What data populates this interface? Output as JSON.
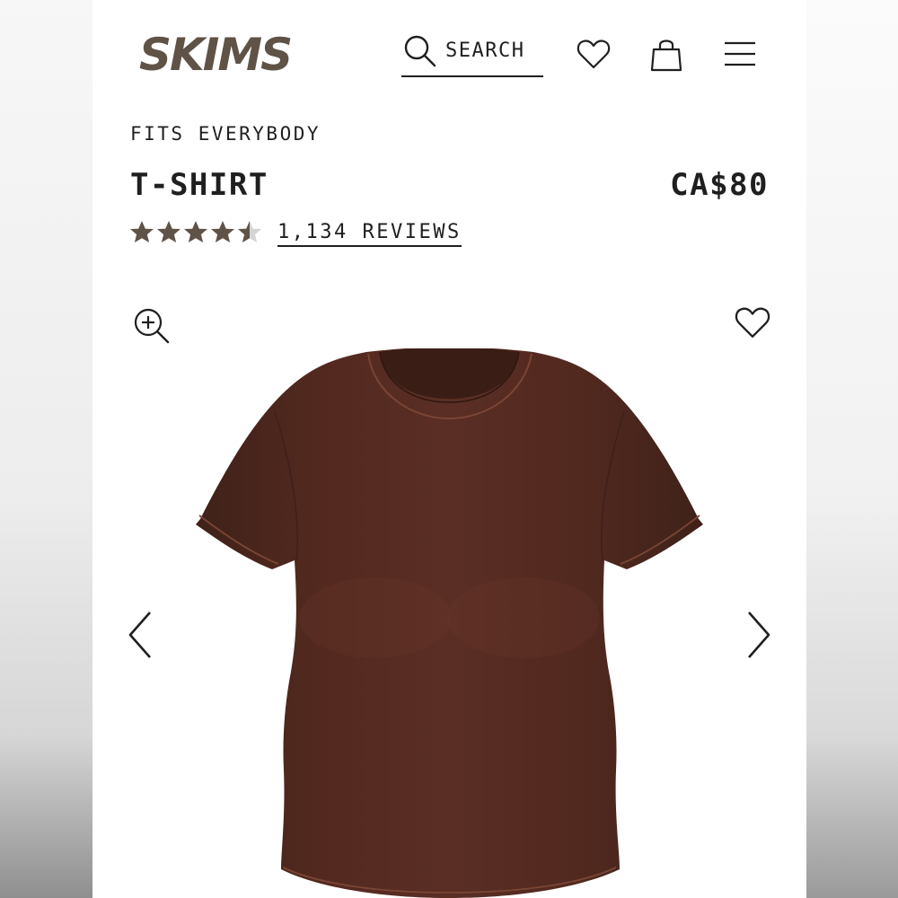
{
  "brand": {
    "name": "SKIMS",
    "color": "#5f5246"
  },
  "header": {
    "search_label": "SEARCH",
    "icons": [
      "search-icon",
      "heart-icon",
      "shopping-bag-icon",
      "menu-icon"
    ]
  },
  "product": {
    "eyebrow": "FITS EVERYBODY",
    "title": "T-SHIRT",
    "price": "CA$80",
    "rating": 4.5,
    "rating_max": 5,
    "reviews_label": "1,134 REVIEWS",
    "color_swatch": "#4e2b22"
  },
  "gallery": {
    "icons": [
      "zoom-in-icon",
      "wishlist-heart-icon",
      "chevron-left-icon",
      "chevron-right-icon"
    ]
  }
}
